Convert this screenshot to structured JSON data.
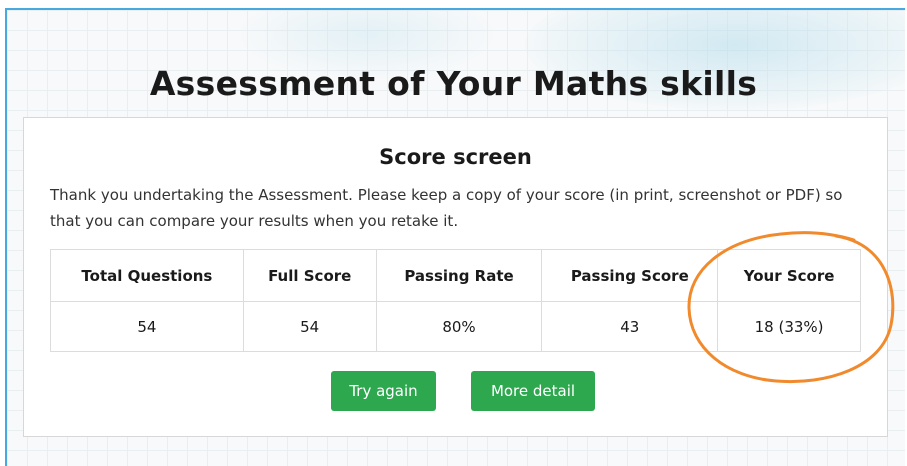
{
  "page": {
    "title": "Assessment of Your Maths skills"
  },
  "card": {
    "title": "Score screen",
    "intro": "Thank you undertaking the Assessment. Please keep a copy of your score (in print, screenshot or PDF) so that you can compare your results when you retake it."
  },
  "score_table": {
    "headers": [
      "Total Questions",
      "Full Score",
      "Passing Rate",
      "Passing Score",
      "Your Score"
    ],
    "values": [
      "54",
      "54",
      "80%",
      "43",
      "18 (33%)"
    ]
  },
  "buttons": {
    "try_again": "Try again",
    "more_detail": "More detail"
  },
  "colors": {
    "button_green": "#2ea84f",
    "highlight_orange": "#f08a2c",
    "frame_blue": "#4aa8e0"
  }
}
